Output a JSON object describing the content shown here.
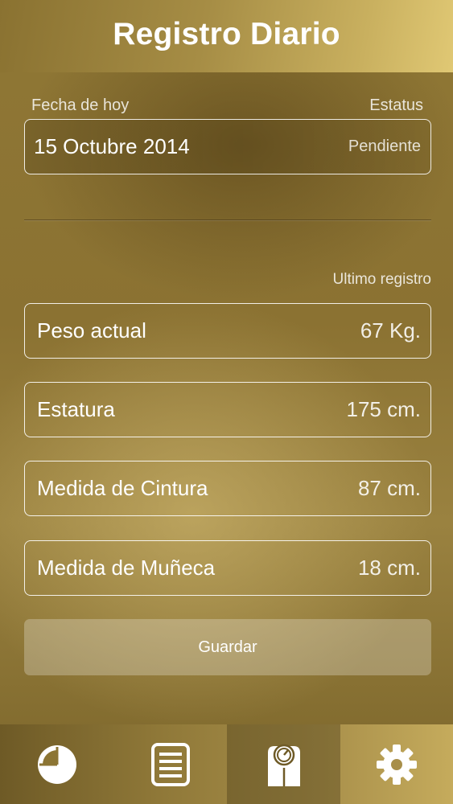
{
  "header": {
    "title": "Registro Diario"
  },
  "today": {
    "date_label": "Fecha de hoy",
    "status_label": "Estatus",
    "date_value": "15 Octubre 2014",
    "status_value": "Pendiente"
  },
  "last_record": {
    "label": "Ultimo registro",
    "items": [
      {
        "name": "Peso actual",
        "value": "67 Kg."
      },
      {
        "name": "Estatura",
        "value": "175 cm."
      },
      {
        "name": "Medida de Cintura",
        "value": "87 cm."
      },
      {
        "name": "Medida de Muñeca",
        "value": "18 cm."
      }
    ]
  },
  "actions": {
    "save_label": "Guardar"
  },
  "tabbar": {
    "tabs": [
      {
        "icon": "pie-chart-icon"
      },
      {
        "icon": "list-icon"
      },
      {
        "icon": "scale-icon",
        "active": true
      },
      {
        "icon": "gear-icon"
      }
    ]
  },
  "colors": {
    "accent": "#c9b05f",
    "background": "#8a7331",
    "text": "#ffffff"
  }
}
